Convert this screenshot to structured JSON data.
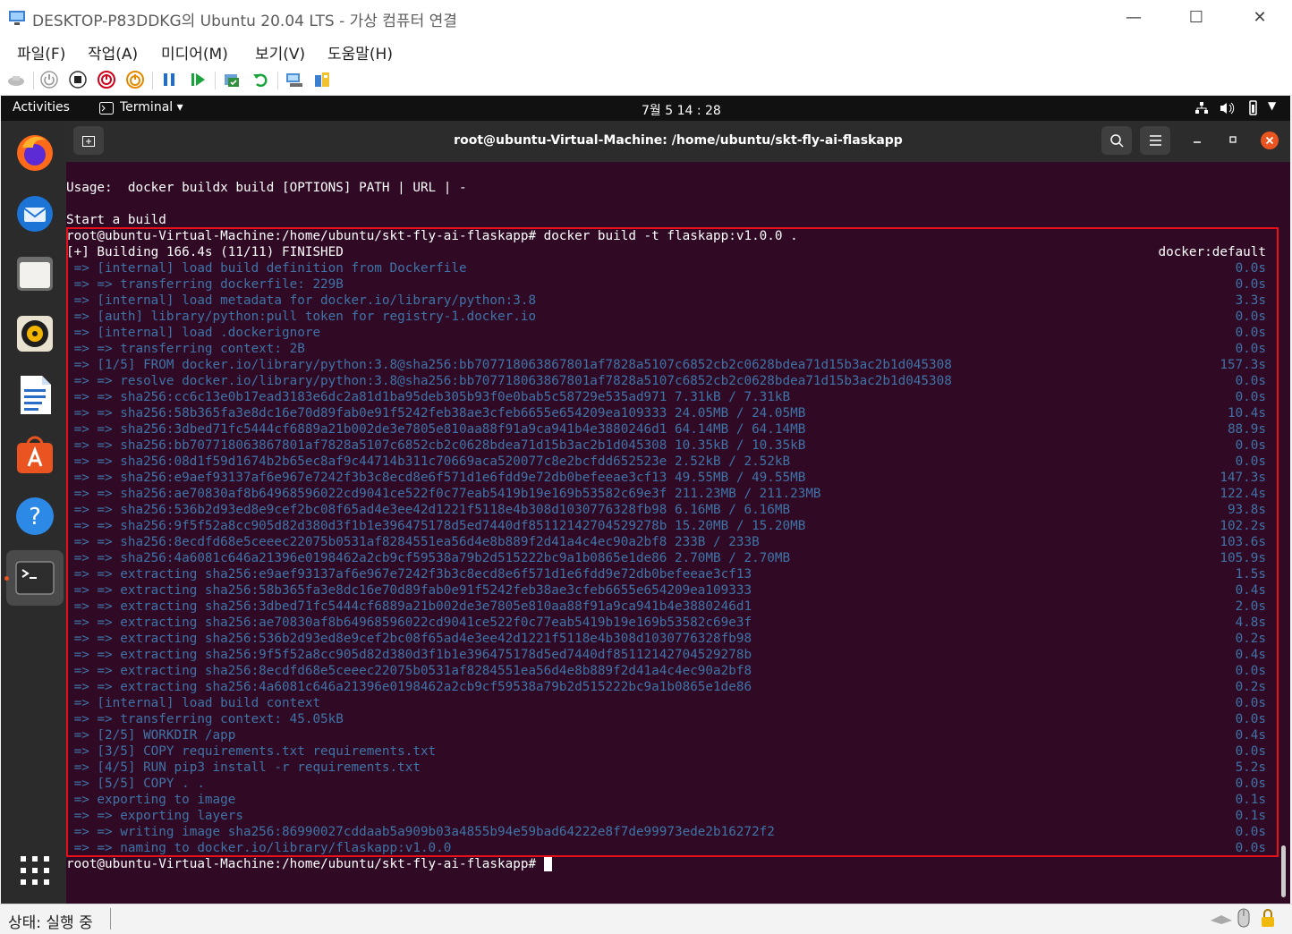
{
  "window": {
    "title": "DESKTOP-P83DDKG의 Ubuntu 20.04 LTS - 가상 컴퓨터 연결",
    "controls": {
      "minimize": "—",
      "maximize": "☐",
      "close": "✕"
    }
  },
  "menubar": {
    "items": [
      "파일(F)",
      "작업(A)",
      "미디어(M)",
      "보기(V)",
      "도움말(H)"
    ]
  },
  "ubuntu_topbar": {
    "activities": "Activities",
    "app_menu": "Terminal ▾",
    "clock": "7월 5  14 : 28"
  },
  "terminal": {
    "title": "root@ubuntu-Virtual-Machine: /home/ubuntu/skt-fly-ai-flaskapp",
    "lines": [
      {
        "text": "Usage:  docker buildx build [OPTIONS] PATH | URL | -",
        "time": "",
        "dim": false
      },
      {
        "text": "",
        "time": "",
        "dim": false
      },
      {
        "text": "Start a build",
        "time": "",
        "dim": false
      },
      {
        "text": "root@ubuntu-Virtual-Machine:/home/ubuntu/skt-fly-ai-flaskapp# docker build -t flaskapp:v1.0.0 .",
        "time": "",
        "dim": false
      },
      {
        "text": "[+] Building 166.4s (11/11) FINISHED",
        "time": "docker:default",
        "dim": false
      },
      {
        "text": " => [internal] load build definition from Dockerfile",
        "time": "0.0s",
        "dim": true
      },
      {
        "text": " => => transferring dockerfile: 229B",
        "time": "0.0s",
        "dim": true
      },
      {
        "text": " => [internal] load metadata for docker.io/library/python:3.8",
        "time": "3.3s",
        "dim": true
      },
      {
        "text": " => [auth] library/python:pull token for registry-1.docker.io",
        "time": "0.0s",
        "dim": true
      },
      {
        "text": " => [internal] load .dockerignore",
        "time": "0.0s",
        "dim": true
      },
      {
        "text": " => => transferring context: 2B",
        "time": "0.0s",
        "dim": true
      },
      {
        "text": " => [1/5] FROM docker.io/library/python:3.8@sha256:bb707718063867801af7828a5107c6852cb2c0628bdea71d15b3ac2b1d045308",
        "time": "157.3s",
        "dim": true
      },
      {
        "text": " => => resolve docker.io/library/python:3.8@sha256:bb707718063867801af7828a5107c6852cb2c0628bdea71d15b3ac2b1d045308",
        "time": "0.0s",
        "dim": true
      },
      {
        "text": " => => sha256:cc6c13e0b17ead3183e6dc2a81d1ba95deb305b93f0e0bab5c58729e535ad971 7.31kB / 7.31kB",
        "time": "0.0s",
        "dim": true
      },
      {
        "text": " => => sha256:58b365fa3e8dc16e70d89fab0e91f5242feb38ae3cfeb6655e654209ea109333 24.05MB / 24.05MB",
        "time": "10.4s",
        "dim": true
      },
      {
        "text": " => => sha256:3dbed71fc5444cf6889a21b002de3e7805e810aa88f91a9ca941b4e3880246d1 64.14MB / 64.14MB",
        "time": "88.9s",
        "dim": true
      },
      {
        "text": " => => sha256:bb707718063867801af7828a5107c6852cb2c0628bdea71d15b3ac2b1d045308 10.35kB / 10.35kB",
        "time": "0.0s",
        "dim": true
      },
      {
        "text": " => => sha256:08d1f59d1674b2b65ec8af9c44714b311c70669aca520077c8e2bcfdd652523e 2.52kB / 2.52kB",
        "time": "0.0s",
        "dim": true
      },
      {
        "text": " => => sha256:e9aef93137af6e967e7242f3b3c8ecd8e6f571d1e6fdd9e72db0befeeae3cf13 49.55MB / 49.55MB",
        "time": "147.3s",
        "dim": true
      },
      {
        "text": " => => sha256:ae70830af8b64968596022cd9041ce522f0c77eab5419b19e169b53582c69e3f 211.23MB / 211.23MB",
        "time": "122.4s",
        "dim": true
      },
      {
        "text": " => => sha256:536b2d93ed8e9cef2bc08f65ad4e3ee42d1221f5118e4b308d1030776328fb98 6.16MB / 6.16MB",
        "time": "93.8s",
        "dim": true
      },
      {
        "text": " => => sha256:9f5f52a8cc905d82d380d3f1b1e396475178d5ed7440df85112142704529278b 15.20MB / 15.20MB",
        "time": "102.2s",
        "dim": true
      },
      {
        "text": " => => sha256:8ecdfd68e5ceeec22075b0531af8284551ea56d4e8b889f2d41a4c4ec90a2bf8 233B / 233B",
        "time": "103.6s",
        "dim": true
      },
      {
        "text": " => => sha256:4a6081c646a21396e0198462a2cb9cf59538a79b2d515222bc9a1b0865e1de86 2.70MB / 2.70MB",
        "time": "105.9s",
        "dim": true
      },
      {
        "text": " => => extracting sha256:e9aef93137af6e967e7242f3b3c8ecd8e6f571d1e6fdd9e72db0befeeae3cf13",
        "time": "1.5s",
        "dim": true
      },
      {
        "text": " => => extracting sha256:58b365fa3e8dc16e70d89fab0e91f5242feb38ae3cfeb6655e654209ea109333",
        "time": "0.4s",
        "dim": true
      },
      {
        "text": " => => extracting sha256:3dbed71fc5444cf6889a21b002de3e7805e810aa88f91a9ca941b4e3880246d1",
        "time": "2.0s",
        "dim": true
      },
      {
        "text": " => => extracting sha256:ae70830af8b64968596022cd9041ce522f0c77eab5419b19e169b53582c69e3f",
        "time": "4.8s",
        "dim": true
      },
      {
        "text": " => => extracting sha256:536b2d93ed8e9cef2bc08f65ad4e3ee42d1221f5118e4b308d1030776328fb98",
        "time": "0.2s",
        "dim": true
      },
      {
        "text": " => => extracting sha256:9f5f52a8cc905d82d380d3f1b1e396475178d5ed7440df85112142704529278b",
        "time": "0.4s",
        "dim": true
      },
      {
        "text": " => => extracting sha256:8ecdfd68e5ceeec22075b0531af8284551ea56d4e8b889f2d41a4c4ec90a2bf8",
        "time": "0.0s",
        "dim": true
      },
      {
        "text": " => => extracting sha256:4a6081c646a21396e0198462a2cb9cf59538a79b2d515222bc9a1b0865e1de86",
        "time": "0.2s",
        "dim": true
      },
      {
        "text": " => [internal] load build context",
        "time": "0.0s",
        "dim": true
      },
      {
        "text": " => => transferring context: 45.05kB",
        "time": "0.0s",
        "dim": true
      },
      {
        "text": " => [2/5] WORKDIR /app",
        "time": "0.4s",
        "dim": true
      },
      {
        "text": " => [3/5] COPY requirements.txt requirements.txt",
        "time": "0.0s",
        "dim": true
      },
      {
        "text": " => [4/5] RUN pip3 install -r requirements.txt",
        "time": "5.2s",
        "dim": true
      },
      {
        "text": " => [5/5] COPY . .",
        "time": "0.0s",
        "dim": true
      },
      {
        "text": " => exporting to image",
        "time": "0.1s",
        "dim": true
      },
      {
        "text": " => => exporting layers",
        "time": "0.1s",
        "dim": true
      },
      {
        "text": " => => writing image sha256:86990027cddaab5a909b03a4855b94e59bad64222e8f7de99973ede2b16272f2",
        "time": "0.0s",
        "dim": true
      },
      {
        "text": " => => naming to docker.io/library/flaskapp:v1.0.0",
        "time": "0.0s",
        "dim": true
      },
      {
        "text": "root@ubuntu-Virtual-Machine:/home/ubuntu/skt-fly-ai-flaskapp# ",
        "time": "",
        "dim": false
      }
    ]
  },
  "statusbar": {
    "status": "상태: 실행 중"
  },
  "colors": {
    "terminal_bg": "#300a24",
    "dim_text": "#3e74a8",
    "highlight": "#e8101a",
    "accent": "#e95420"
  }
}
